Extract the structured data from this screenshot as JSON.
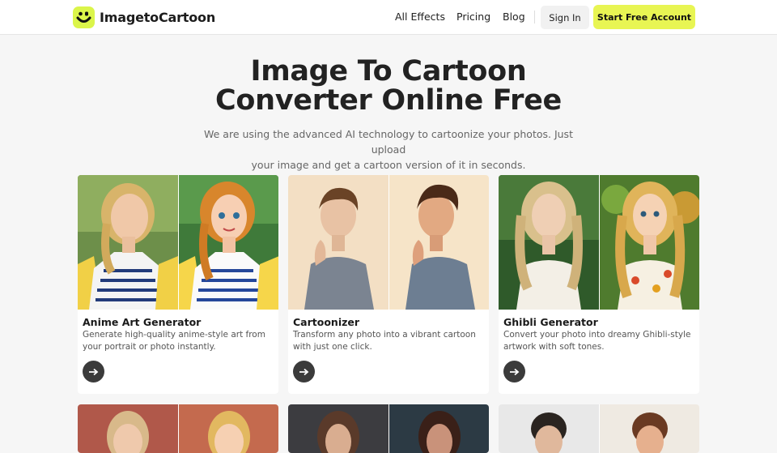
{
  "header": {
    "brand": "ImagetoCartoon",
    "nav": [
      "All Effects",
      "Pricing",
      "Blog"
    ],
    "sign_in": "Sign In",
    "cta": "Start Free Account"
  },
  "hero": {
    "title_line1": "Image To Cartoon",
    "title_line2": "Converter Online Free",
    "subtitle_line1": "We are using the advanced AI technology to cartoonize your photos. Just upload",
    "subtitle_line2": "your image and get a cartoon version of it in seconds."
  },
  "cards": [
    {
      "title": "Anime Art Generator",
      "desc": "Generate high-quality anime-style art from your portrait or photo instantly."
    },
    {
      "title": "Cartoonizer",
      "desc": "Transform any photo into a vibrant cartoon with just one click."
    },
    {
      "title": "Ghibli Generator",
      "desc": "Convert your photo into dreamy Ghibli-style artwork with soft tones."
    }
  ],
  "colors": {
    "accent": "#e8f553",
    "logo_bg": "#dbf54a",
    "arrow_button": "#3b3b3b"
  },
  "icons": {
    "logo": "smiley-face-icon",
    "card_action": "arrow-right-icon"
  }
}
